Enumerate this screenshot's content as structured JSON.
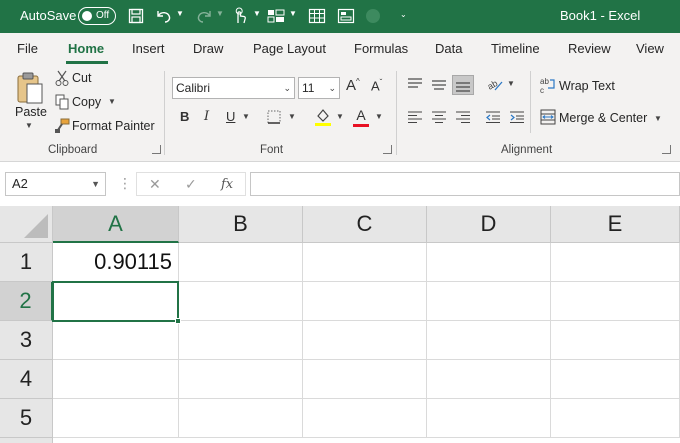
{
  "titlebar": {
    "autosave_label": "AutoSave",
    "autosave_state": "Off",
    "document_title": "Book1 - Excel",
    "bg_color": "#217346"
  },
  "tabs": [
    "File",
    "Home",
    "Insert",
    "Draw",
    "Page Layout",
    "Formulas",
    "Data",
    "Timeline",
    "Review",
    "View"
  ],
  "active_tab": "Home",
  "ribbon": {
    "clipboard": {
      "paste_label": "Paste",
      "cut_label": "Cut",
      "copy_label": "Copy",
      "format_painter_label": "Format Painter",
      "group_label": "Clipboard"
    },
    "font": {
      "font_name": "Calibri",
      "font_size": "11",
      "bold": "B",
      "italic": "I",
      "underline": "U",
      "font_color_glyph": "A",
      "group_label": "Font",
      "highlight_color": "#ffff00",
      "font_color": "#e81123"
    },
    "alignment": {
      "wrap_text_label": "Wrap Text",
      "merge_center_label": "Merge & Center",
      "group_label": "Alignment"
    }
  },
  "formula_bar": {
    "name_box": "A2",
    "fx_label": "fx",
    "formula_value": ""
  },
  "sheet": {
    "columns": [
      "A",
      "B",
      "C",
      "D",
      "E"
    ],
    "rows": [
      "1",
      "2",
      "3",
      "4",
      "5"
    ],
    "selected_column": "A",
    "selected_row": "2",
    "cells": {
      "A1": "0.90115"
    }
  }
}
